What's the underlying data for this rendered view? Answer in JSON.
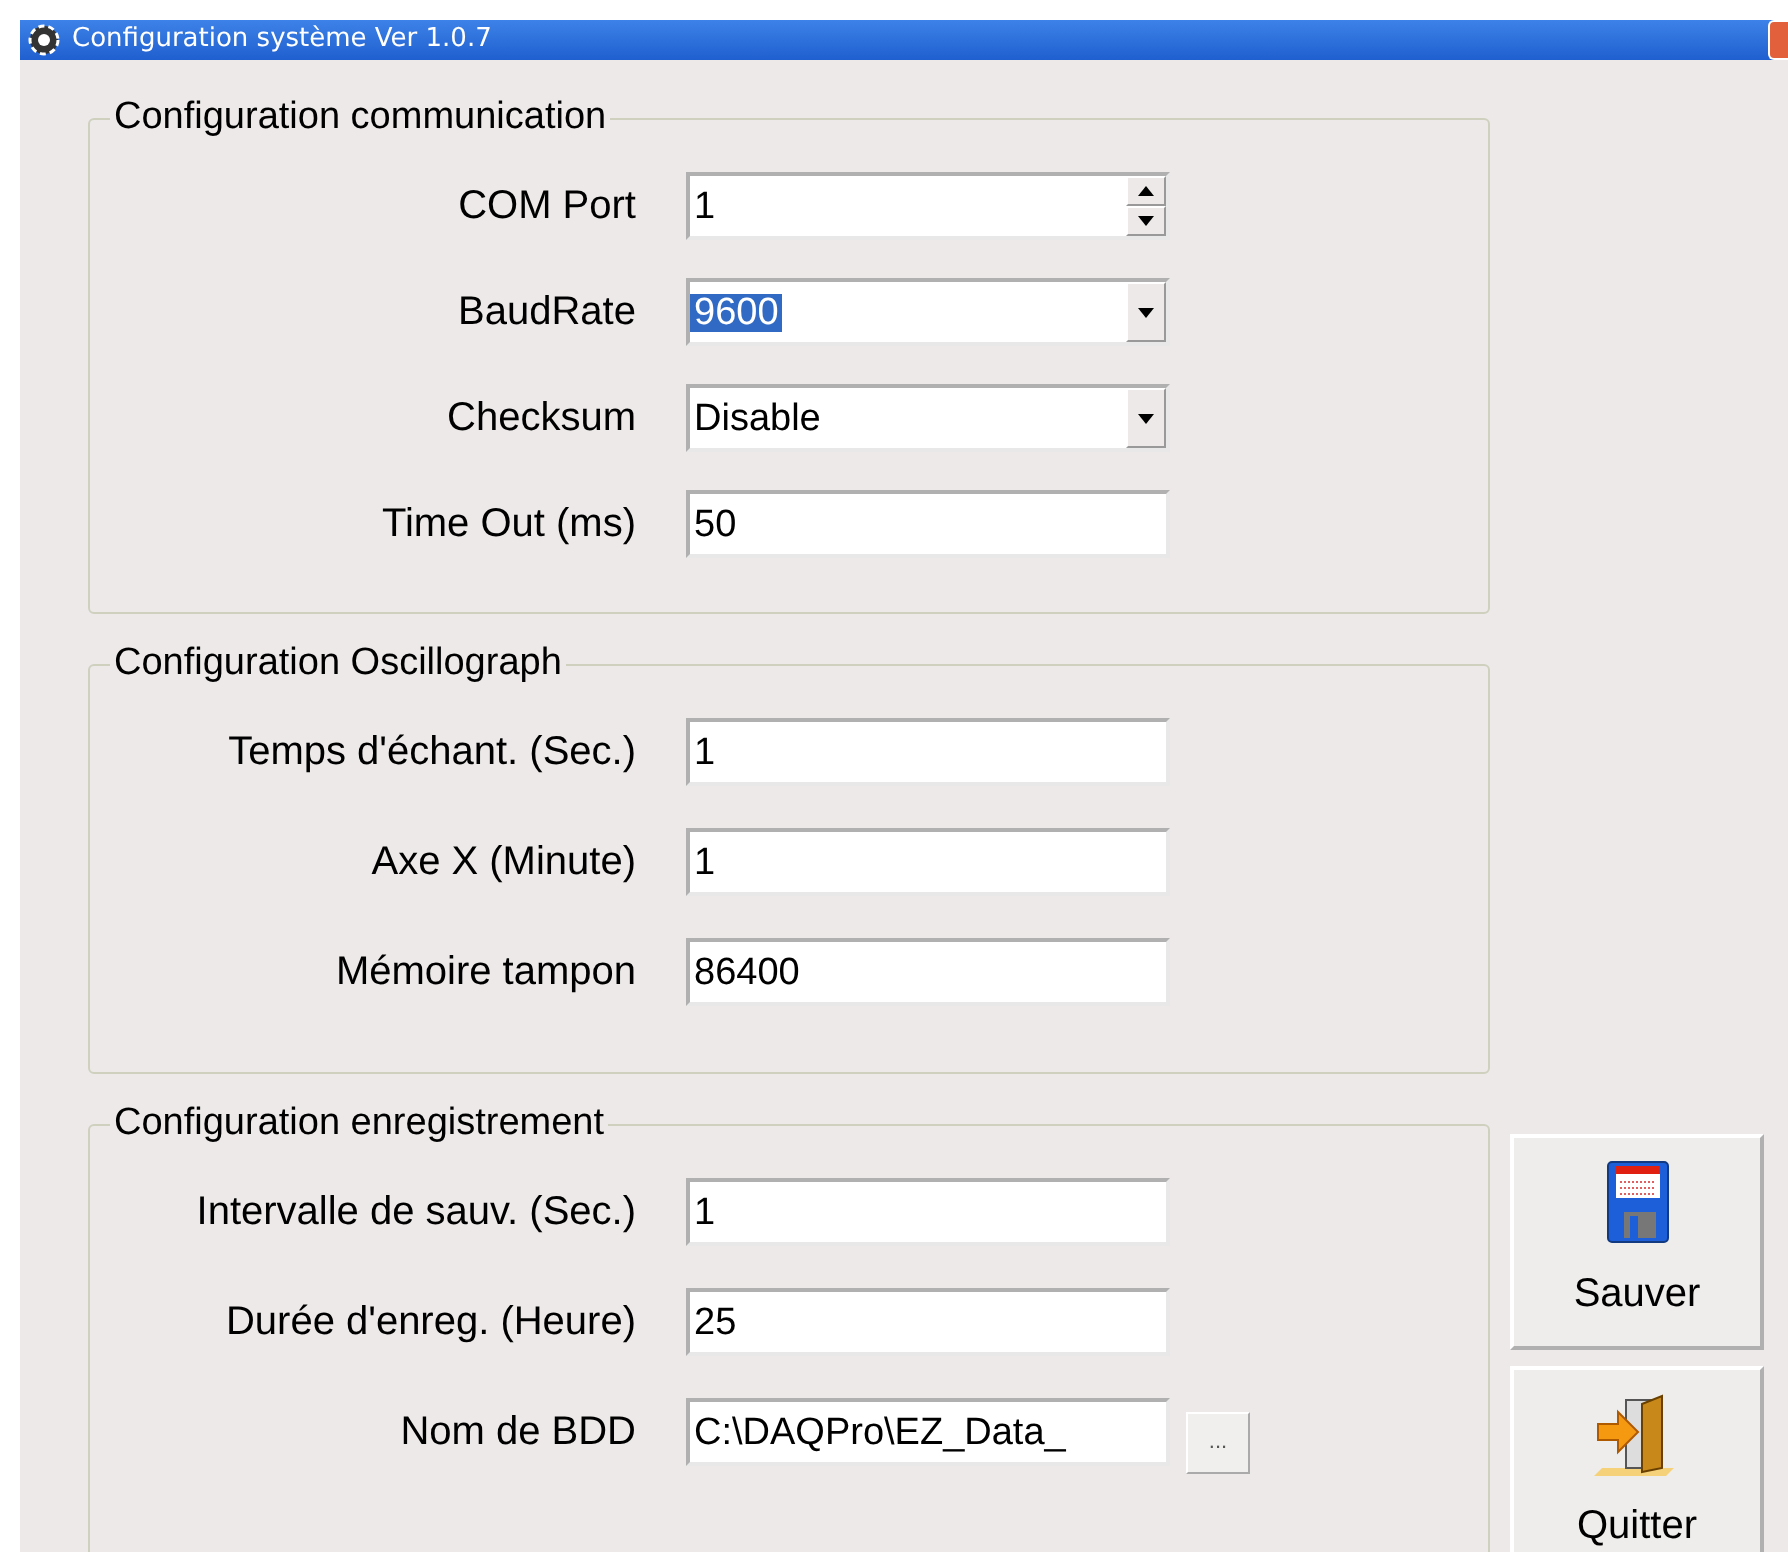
{
  "window": {
    "title": "Configuration système Ver 1.0.7"
  },
  "groups": [
    {
      "title": "Configuration communication",
      "rows": [
        {
          "label": "COM Port",
          "kind": "spin",
          "value": "1"
        },
        {
          "label": "BaudRate",
          "kind": "combo",
          "value": "9600",
          "selected": true
        },
        {
          "label": "Checksum",
          "kind": "combo",
          "value": "Disable",
          "selected": false
        },
        {
          "label": "Time Out (ms)",
          "kind": "text",
          "value": "50"
        }
      ]
    },
    {
      "title": "Configuration Oscillograph",
      "rows": [
        {
          "label": "Temps d'échant. (Sec.)",
          "kind": "text",
          "value": "1"
        },
        {
          "label": "Axe X (Minute)",
          "kind": "text",
          "value": "1"
        },
        {
          "label": "Mémoire tampon",
          "kind": "text",
          "value": "86400"
        }
      ]
    },
    {
      "title": "Configuration enregistrement",
      "rows": [
        {
          "label": "Intervalle de sauv. (Sec.)",
          "kind": "text",
          "value": "1"
        },
        {
          "label": "Durée d'enreg. (Heure)",
          "kind": "text",
          "value": "25"
        },
        {
          "label": "Nom de BDD",
          "kind": "browse",
          "value": "C:\\DAQPro\\EZ_Data_",
          "button": "..."
        }
      ]
    }
  ],
  "buttons": [
    {
      "label": "Sauver",
      "kind": "save"
    },
    {
      "label": "Quitter",
      "kind": "exit"
    }
  ]
}
